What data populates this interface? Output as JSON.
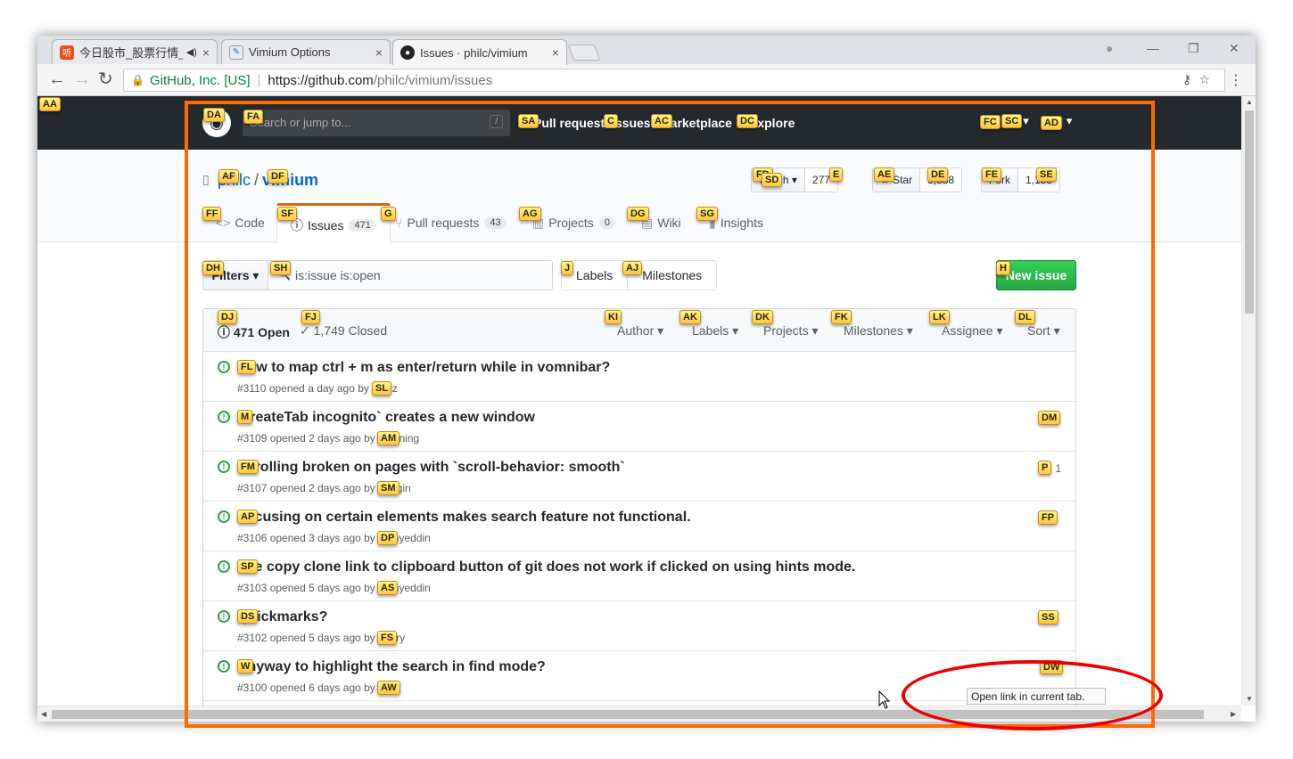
{
  "browser": {
    "tabs": [
      {
        "title": "今日股市_股票行情_股",
        "favicon": "听",
        "audio": "◀)"
      },
      {
        "title": "Vimium Options",
        "favicon": "✎"
      },
      {
        "title": "Issues · philc/vimium",
        "favicon": "●"
      }
    ],
    "site_identity": "GitHub, Inc. [US]",
    "url_host": "https://github.com",
    "url_path": "/philc/vimium/issues"
  },
  "github_header": {
    "search_placeholder": "Search or jump to...",
    "slash_key": "/",
    "nav": [
      "Pull requests",
      "Issues",
      "Marketplace",
      "Explore"
    ]
  },
  "repo": {
    "owner": "philc",
    "name": "vimium",
    "watch_label": "Watch ▾",
    "watch_count": "277",
    "star_label": "★ Star",
    "star_count": "9,388",
    "fork_label": "Fork",
    "fork_count": "1,155",
    "tabs": [
      {
        "label": "Code"
      },
      {
        "label": "Issues",
        "count": "471"
      },
      {
        "label": "Pull requests",
        "count": "43"
      },
      {
        "label": "Projects",
        "count": "0"
      },
      {
        "label": "Wiki"
      },
      {
        "label": "Insights"
      }
    ]
  },
  "filters": {
    "filters_label": "Filters ▾",
    "query": "is:issue is:open",
    "labels_label": "Labels",
    "milestones_label": "Milestones",
    "new_issue_label": "New issue"
  },
  "issue_list": {
    "open_label": "471 Open",
    "closed_label": "✓ 1,749 Closed",
    "sort_options": [
      "Author ▾",
      "Labels ▾",
      "Projects ▾",
      "Milestones ▾",
      "Assignee ▾",
      "Sort ▾"
    ],
    "issues": [
      {
        "title": "How to map ctrl + m as enter/return while in vomnibar?",
        "meta": "#3110 opened a day ago by syruz",
        "comments": ""
      },
      {
        "title": "`createTab incognito` creates a new window",
        "meta": "#3109 opened 2 days ago by manning",
        "comments": ""
      },
      {
        "title": "Scrolling broken on pages with `scroll-behavior: smooth`",
        "meta": "#3107 opened 2 days ago by margin",
        "comments": "1"
      },
      {
        "title": "Focusing on certain elements makes search feature not functional.",
        "meta": "#3106 opened 3 days ago by mohyeddin",
        "comments": ""
      },
      {
        "title": "The copy clone link to clipboard button of git does not work if clicked on using hints mode.",
        "meta": "#3103 opened 5 days ago by mohyeddin",
        "comments": ""
      },
      {
        "title": "Quickmarks?",
        "meta": "#3102 opened 5 days ago by angry",
        "comments": ""
      },
      {
        "title": "Anyway to highlight the search in find mode?",
        "meta": "#3100 opened 6 days ago by an",
        "comments": ""
      }
    ]
  },
  "vimium_hints": [
    "AA",
    "DA",
    "FA",
    "SA",
    "C",
    "AC",
    "DC",
    "FC",
    "SC",
    "AD",
    "AF",
    "DF",
    "FD",
    "SD",
    "E",
    "AE",
    "DE",
    "FE",
    "SE",
    "FF",
    "SF",
    "G",
    "AG",
    "DG",
    "SG",
    "DH",
    "SH",
    "J",
    "AJ",
    "H",
    "DJ",
    "FJ",
    "KI",
    "AK",
    "DK",
    "FK",
    "LK",
    "DL",
    "FL",
    "SL",
    "M",
    "DM",
    "AM",
    "FM",
    "P",
    "SM",
    "AP",
    "FP",
    "DP",
    "SP",
    "AS",
    "DS",
    "SS",
    "FS",
    "W",
    "DW",
    "AW"
  ],
  "tooltip": "Open link in current tab.",
  "colors": {
    "annotation_box": "#ff6a00",
    "annotation_ellipse": "#e00000",
    "github_header": "#24292e",
    "new_issue": "#28a745",
    "open_icon": "#28a745",
    "link": "#0366d6",
    "hint_bg": "#ffd54a"
  }
}
